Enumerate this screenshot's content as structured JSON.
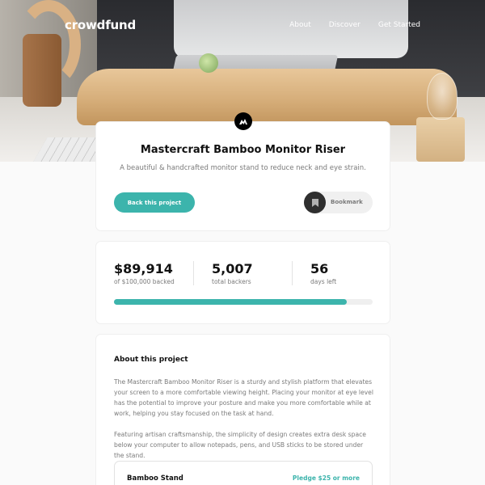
{
  "header": {
    "logo": "crowdfund",
    "nav": [
      "About",
      "Discover",
      "Get Started"
    ]
  },
  "intro": {
    "brand_icon": "mastercraft-logo-icon",
    "title": "Mastercraft Bamboo Monitor Riser",
    "description": "A beautiful & handcrafted monitor stand to reduce neck and eye strain.",
    "back_label": "Back this project",
    "bookmark_label": "Bookmark",
    "bookmark_icon": "bookmark-icon"
  },
  "stats": {
    "backed_amount": "$89,914",
    "backed_caption": "of $100,000 backed",
    "backers": "5,007",
    "backers_caption": "total backers",
    "days": "56",
    "days_caption": "days left",
    "progress": 0.89914
  },
  "about": {
    "heading": "About this project",
    "paragraphs": [
      "The Mastercraft Bamboo Monitor Riser is a sturdy and stylish platform that elevates your screen to a more comfortable viewing height. Placing your monitor at eye level has the potential to improve your posture and make you more comfortable while at work, helping you stay focused on the task at hand.",
      "Featuring artisan craftsmanship, the simplicity of design creates extra desk space below your computer to allow notepads, pens, and USB sticks to be stored under the stand."
    ],
    "reward": {
      "name": "Bamboo Stand",
      "pledge": "Pledge $25 or more"
    }
  },
  "colors": {
    "accent": "#3cb4ac",
    "dark": "#2f2f2f"
  }
}
